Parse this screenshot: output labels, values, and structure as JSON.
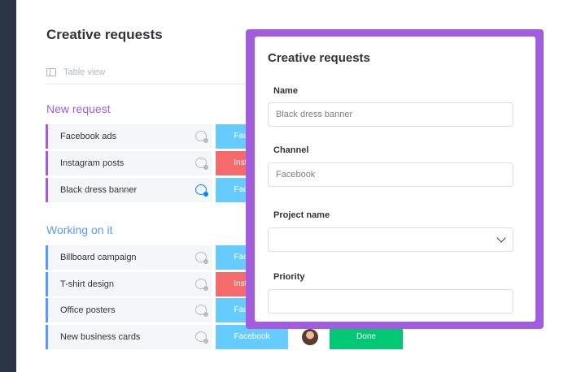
{
  "board": {
    "title": "Creative requests",
    "view_label": "Table view"
  },
  "groups": [
    {
      "title": "New request",
      "color": "#a25ddc",
      "rows": [
        {
          "name": "Facebook ads",
          "status": "Facebook"
        },
        {
          "name": "Instagram posts",
          "status": "Instagram"
        },
        {
          "name": "Black dress banner",
          "status": "Facebook"
        }
      ]
    },
    {
      "title": "Working on it",
      "color": "#579bfc",
      "rows": [
        {
          "name": "Billboard campaign",
          "status": "Facebook"
        },
        {
          "name": "T-shirt design",
          "status": "Instagram"
        },
        {
          "name": "Office posters",
          "status": "Facebook"
        },
        {
          "name": "New business cards",
          "status": "Facebook",
          "progress": "Done"
        }
      ]
    }
  ],
  "modal": {
    "title": "Creative requests",
    "fields": {
      "name": {
        "label": "Name",
        "placeholder": "Black dress banner"
      },
      "channel": {
        "label": "Channel",
        "placeholder": "Facebook"
      },
      "project": {
        "label": "Project name",
        "value": ""
      },
      "priority": {
        "label": "Priority",
        "value": ""
      }
    }
  },
  "colors": {
    "accent": "#a25ddc",
    "facebook": "#66ccff",
    "instagram": "#f56b6b",
    "done": "#00c875"
  }
}
